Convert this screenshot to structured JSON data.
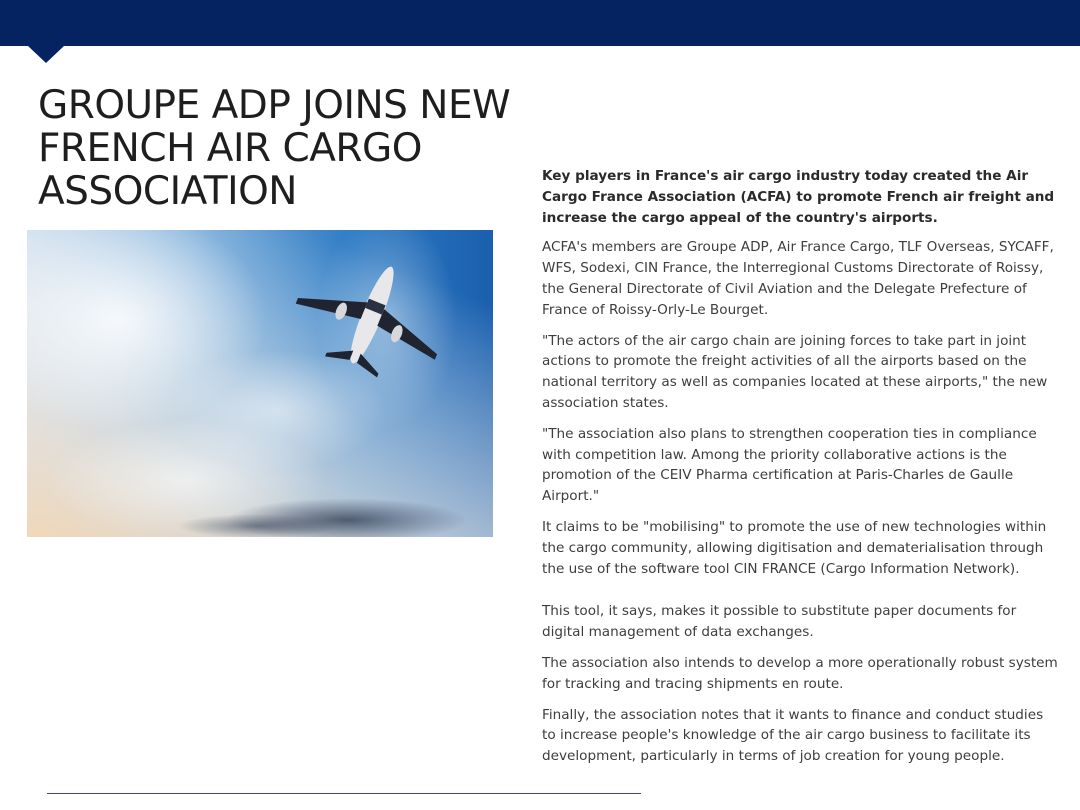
{
  "header": {
    "color": "#062361"
  },
  "slide": {
    "title": "GROUPE ADP JOINS NEW FRENCH AIR CARGO ASSOCIATION",
    "image": {
      "description_icon": "airplane-in-sky-photo"
    },
    "article": {
      "lead": "Key players in France's air cargo industry today created the Air Cargo France Association (ACFA) to promote French air freight and increase the cargo appeal of the country's airports.",
      "p1": "ACFA's members are Groupe ADP, Air France Cargo, TLF Overseas, SYCAFF, WFS, Sodexi, CIN France, the Interregional Customs Directorate of Roissy, the General Directorate of Civil Aviation and the Delegate Prefecture of France of Roissy-Orly-Le Bourget.",
      "p2": "\"The actors of the air cargo chain are joining forces to take part in joint actions to promote the freight activities of all the airports based on the national territory as well as companies located at these airports,\" the new association states.",
      "p3": "\"The association also plans to strengthen cooperation ties in compliance with competition law. Among the priority collaborative actions is the promotion of the CEIV Pharma certification at Paris-Charles de Gaulle Airport.\"",
      "p4": "It claims to be \"mobilising\" to promote the use of new technologies within the cargo community, allowing digitisation and dematerialisation through the use of the software tool CIN FRANCE (Cargo Information Network).",
      "p5": "This tool, it says, makes it possible to substitute paper documents for digital management of data exchanges.",
      "p6": "The association also intends to develop a more operationally robust system for tracking and tracing shipments en route.",
      "p7": "Finally, the association notes that it wants to finance and conduct studies to increase people's knowledge of the air cargo business to facilitate its development, particularly in terms of job creation for young people."
    }
  },
  "footer": {
    "line_color": "#3346b8"
  }
}
